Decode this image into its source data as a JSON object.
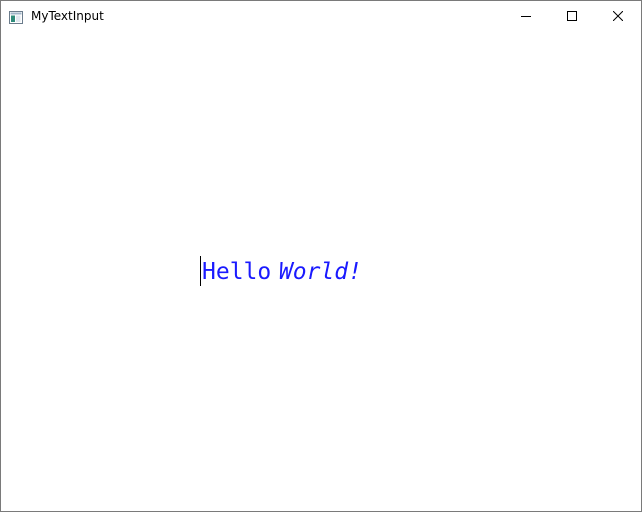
{
  "window": {
    "title": "MyTextInput",
    "icon": "app-window-icon",
    "controls": {
      "minimize_icon": "minimize-icon",
      "maximize_icon": "maximize-icon",
      "close_icon": "close-icon"
    }
  },
  "text_input": {
    "regular_text": "Hello",
    "separator": " ",
    "italic_text": "World!",
    "text_color": "#1a1aff",
    "caret_position": 0
  }
}
